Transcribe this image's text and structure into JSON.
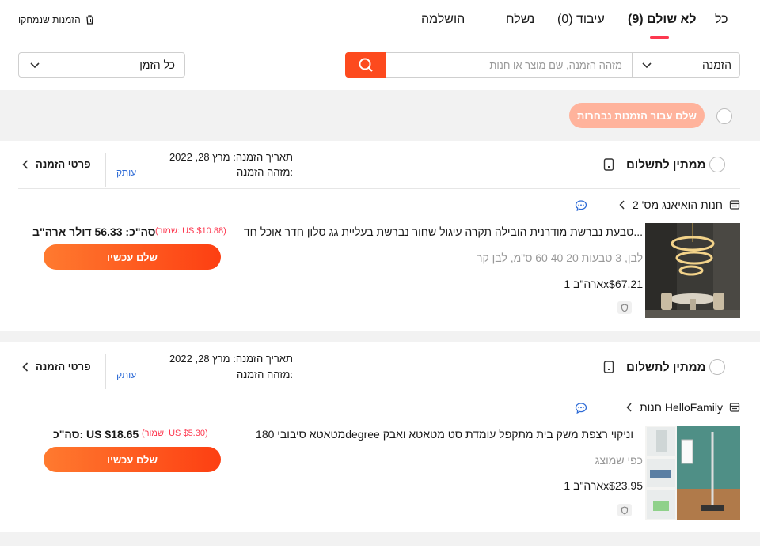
{
  "tabs": [
    {
      "label": "כל"
    },
    {
      "label": "לא שולם (9)"
    },
    {
      "label": "עיבוד (0)"
    },
    {
      "label": "נשלח"
    },
    {
      "label": "הושלמה"
    }
  ],
  "deleted_orders_label": "הזמנות שנמחקו",
  "search": {
    "type_select": "הזמנה",
    "placeholder": "מזהה הזמנה, שם מוצר או חנות",
    "time_select": "כל הזמן"
  },
  "pay_selected_label": "שלם עבור הזמנות נבחרות",
  "orders": [
    {
      "status": "ממתין לתשלום",
      "order_date": "תאריך הזמנה: מרץ 28, 2022",
      "order_id_label": "מזהה הזמנה:",
      "copy_label": "עותק",
      "details_label": "פרטי הזמנה",
      "store": "חנות הואיאנג מס' 2",
      "product_title": "טבעת נברשת מודרנית הובילה תקרה עיגול שחור נברשת בעליית גג סלון חדר אוכל חד...",
      "variant": "לבן, 3 טבעות 20 40 60 ס\"מ, לבן קר",
      "qty_price": "ארה\"ב 1x$67.21",
      "saved": "(שמור: US $10.88)",
      "total": "סה\"כ: 56.33 דולר ארה\"ב",
      "pay_now": "שלם עכשיו"
    },
    {
      "status": "ממתין לתשלום",
      "order_date": "תאריך הזמנה: מרץ 28, 2022",
      "order_id_label": "מזהה הזמנה:",
      "copy_label": "עותק",
      "details_label": "פרטי הזמנה",
      "store": "חנות HelloFamily",
      "product_title": "מטאטא סיבובי 180degree וניקוי רצפת משק בית מתקפל עומדת סט מטאטא ואבק",
      "variant": "כפי שמוצג",
      "qty_price": "ארה\"ב 1x$23.95",
      "saved": "(שמור: US $5.30)",
      "total": "סה\"כ: US $18.65",
      "pay_now": "שלם עכשיו"
    }
  ],
  "colors": {
    "accent": "#fd4a1e",
    "link": "#2e6bd6",
    "saved": "#fd384f"
  }
}
